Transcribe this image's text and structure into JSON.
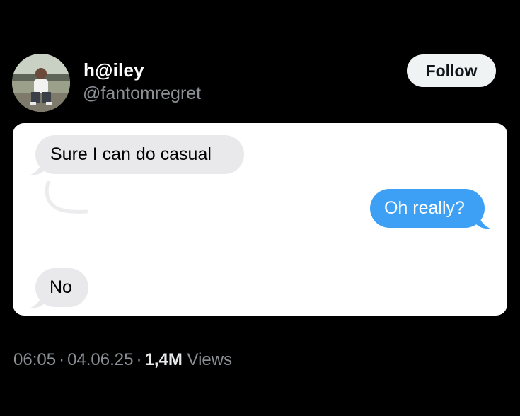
{
  "post": {
    "display_name": "h@iley",
    "handle": "@fantomregret",
    "follow_label": "Follow",
    "time": "06:05",
    "date": "04.06.25",
    "views_count": "1,4M",
    "views_label": "Views",
    "separator": "·"
  },
  "messages": [
    {
      "direction": "incoming",
      "text": "Sure I can do casual"
    },
    {
      "direction": "outgoing",
      "text": "Oh really?"
    },
    {
      "direction": "incoming",
      "text": "No"
    }
  ],
  "colors": {
    "background": "#000000",
    "incoming_bubble": "#e9e9eb",
    "outgoing_bubble": "#3ea0f5",
    "muted_text": "#8b9096"
  },
  "icons": {
    "avatar": "profile-photo",
    "edit_mark": "squiggle-mark"
  }
}
